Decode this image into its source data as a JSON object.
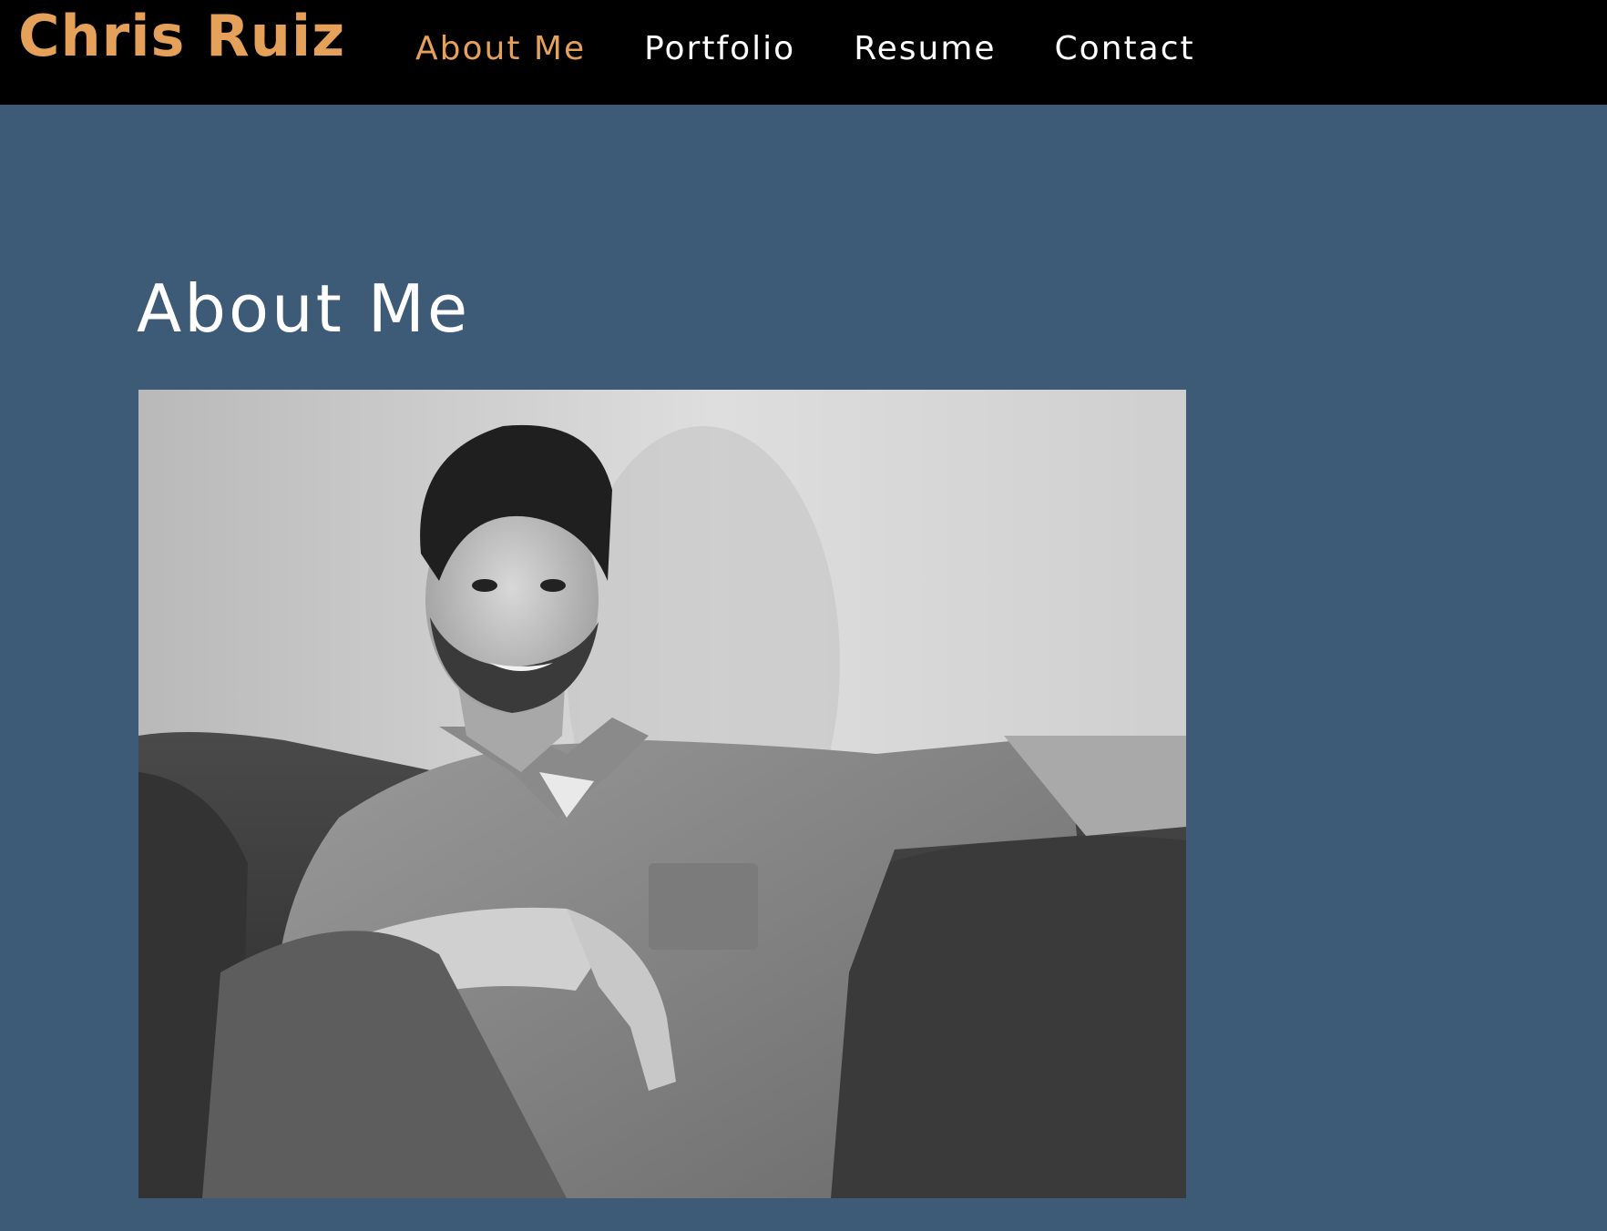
{
  "site": {
    "brand": "Chris Ruiz"
  },
  "nav": {
    "items": [
      {
        "label": "About Me",
        "active": true
      },
      {
        "label": "Portfolio",
        "active": false
      },
      {
        "label": "Resume",
        "active": false
      },
      {
        "label": "Contact",
        "active": false
      }
    ]
  },
  "main": {
    "title": "About Me",
    "photo_subject": "black-and-white portrait of a smiling bearded man in a denim shirt seated on a couch"
  },
  "colors": {
    "header_bg": "#000000",
    "page_bg": "#3d5a77",
    "accent": "#e5a15a",
    "text": "#ffffff"
  }
}
